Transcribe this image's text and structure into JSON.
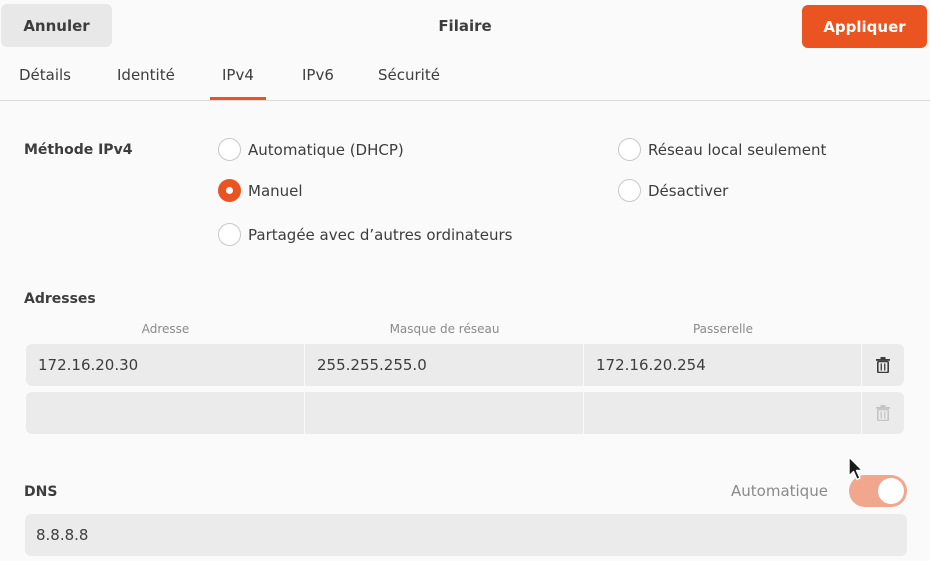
{
  "header": {
    "cancel_label": "Annuler",
    "title": "Filaire",
    "apply_label": "Appliquer"
  },
  "tabs": [
    {
      "label": "Détails",
      "active": false
    },
    {
      "label": "Identité",
      "active": false
    },
    {
      "label": "IPv4",
      "active": true
    },
    {
      "label": "IPv6",
      "active": false
    },
    {
      "label": "Sécurité",
      "active": false
    }
  ],
  "ipv4": {
    "method_label": "Méthode IPv4",
    "methods": [
      {
        "label": "Automatique (DHCP)",
        "checked": false
      },
      {
        "label": "Réseau local seulement",
        "checked": false
      },
      {
        "label": "Manuel",
        "checked": true
      },
      {
        "label": "Désactiver",
        "checked": false
      },
      {
        "label": "Partagée avec d’autres ordinateurs",
        "checked": false
      }
    ]
  },
  "addresses": {
    "section_label": "Adresses",
    "columns": [
      "Adresse",
      "Masque de réseau",
      "Passerelle"
    ],
    "rows": [
      {
        "address": "172.16.20.30",
        "netmask": "255.255.255.0",
        "gateway": "172.16.20.254"
      },
      {
        "address": "",
        "netmask": "",
        "gateway": ""
      }
    ]
  },
  "dns": {
    "section_label": "DNS",
    "auto_label": "Automatique",
    "auto_enabled": true,
    "value": "8.8.8.8"
  },
  "icons": {
    "delete": "trash-icon",
    "cursor": "mouse-pointer-icon"
  },
  "colors": {
    "accent": "#e95420",
    "toggle_on_dimmed": "#f0a78e",
    "field_bg": "#ebebeb"
  }
}
